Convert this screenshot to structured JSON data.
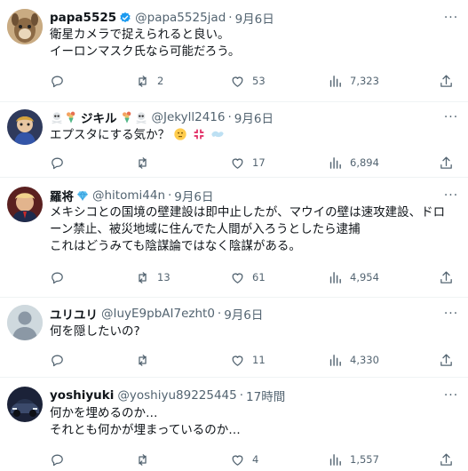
{
  "tweets": [
    {
      "name": "papa5525",
      "handle": "@papa5525jad",
      "date": "9月6日",
      "lines": [
        "衛星カメラで捉えられると良い。",
        "イーロンマスク氏なら可能だろう。"
      ],
      "replies": "",
      "retweets": "2",
      "likes": "53",
      "views": "7,323"
    },
    {
      "name": "ジキル",
      "handle": "@Jekyll2416",
      "date": "9月6日",
      "lines": [
        "エプスタにする気か？"
      ],
      "replies": "",
      "retweets": "",
      "likes": "17",
      "views": "6,894"
    },
    {
      "name": "羅将",
      "handle": "@hitomi44n",
      "date": "9月6日",
      "lines": [
        "メキシコとの国境の壁建設は即中止したが、マウイの壁は速攻建設、ドローン禁止、被災地域に住んでた人間が入ろうとしたら逮捕",
        "これはどうみても陰謀論ではなく陰謀がある。"
      ],
      "replies": "",
      "retweets": "13",
      "likes": "61",
      "views": "4,954"
    },
    {
      "name": "ユリユリ",
      "handle": "@IuyE9pbAI7ezht0",
      "date": "9月6日",
      "lines": [
        "何を隠したいの?"
      ],
      "replies": "",
      "retweets": "",
      "likes": "11",
      "views": "4,330"
    },
    {
      "name": "yoshiyuki",
      "handle": "@yoshiyu89225445",
      "date": "17時間",
      "lines": [
        "何かを埋めるのか…",
        "それとも何かが埋まっているのか…"
      ],
      "replies": "",
      "retweets": "",
      "likes": "4",
      "views": "1,557"
    }
  ],
  "icons": {
    "reply": "speech-bubble-icon",
    "retweet": "retweet-arrows-icon",
    "like": "heart-icon",
    "views": "bar-chart-icon",
    "share": "share-arrow-up-icon",
    "more": "three-dots-icon"
  },
  "colors": {
    "text": "#0f1419",
    "secondary": "#536471",
    "verified": "#1d9bf0",
    "border": "#eff3f4"
  }
}
